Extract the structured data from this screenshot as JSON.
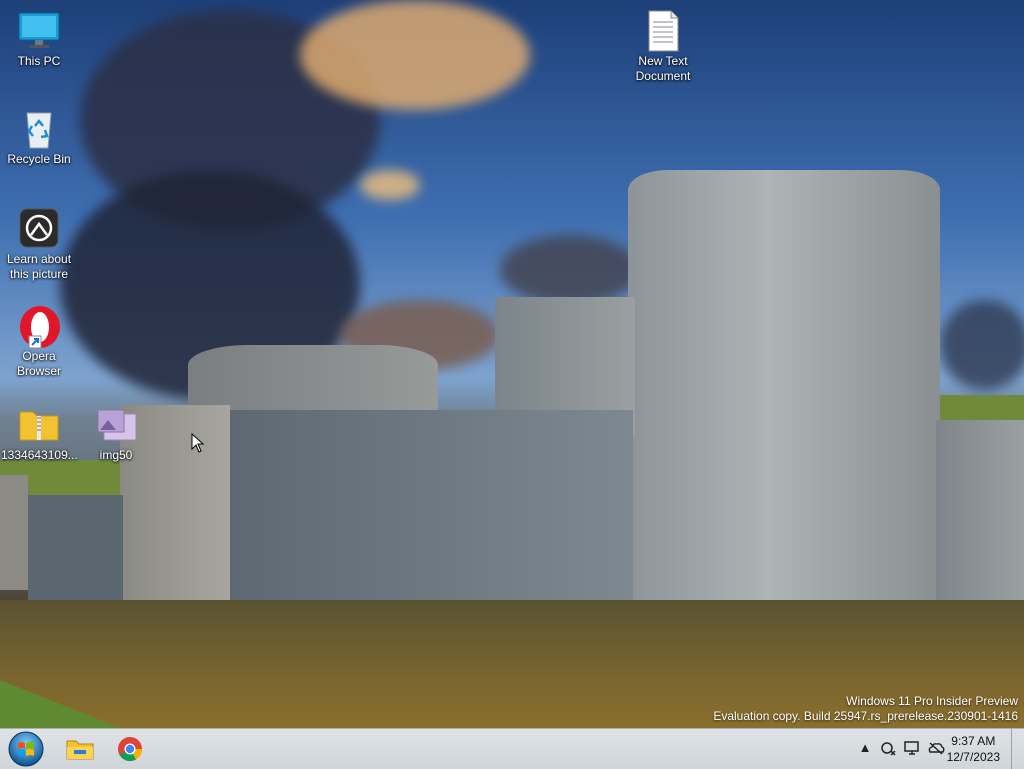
{
  "desktop": {
    "icons": [
      {
        "label": "This PC",
        "icon": "monitor-icon"
      },
      {
        "label": "Recycle Bin",
        "icon": "recycle-bin-icon"
      },
      {
        "label": "Learn about this picture",
        "icon": "camera-icon"
      },
      {
        "label": "Opera Browser",
        "icon": "opera-icon"
      },
      {
        "label": "1334643109...",
        "icon": "zip-folder-icon"
      },
      {
        "label": "img50",
        "icon": "image-file-icon"
      },
      {
        "label": "New Text Document",
        "icon": "text-document-icon"
      }
    ],
    "watermark": {
      "line1": "Windows 11 Pro Insider Preview",
      "line2": "Evaluation copy. Build 25947.rs_prerelease.230901-1416"
    }
  },
  "taskbar": {
    "pinned": [
      "start-orb-icon",
      "file-explorer-icon",
      "chrome-icon"
    ],
    "tray": [
      "chevron-up-icon",
      "network-icon",
      "display-icon",
      "onedrive-offline-icon"
    ],
    "clock": {
      "time": "9:37 AM",
      "date": "12/7/2023"
    }
  },
  "colors": {
    "taskbar_bg": "#d6dbdf",
    "sky_top": "#1d3f78",
    "opera_red": "#e0162b",
    "folder_yellow": "#f2c232"
  }
}
